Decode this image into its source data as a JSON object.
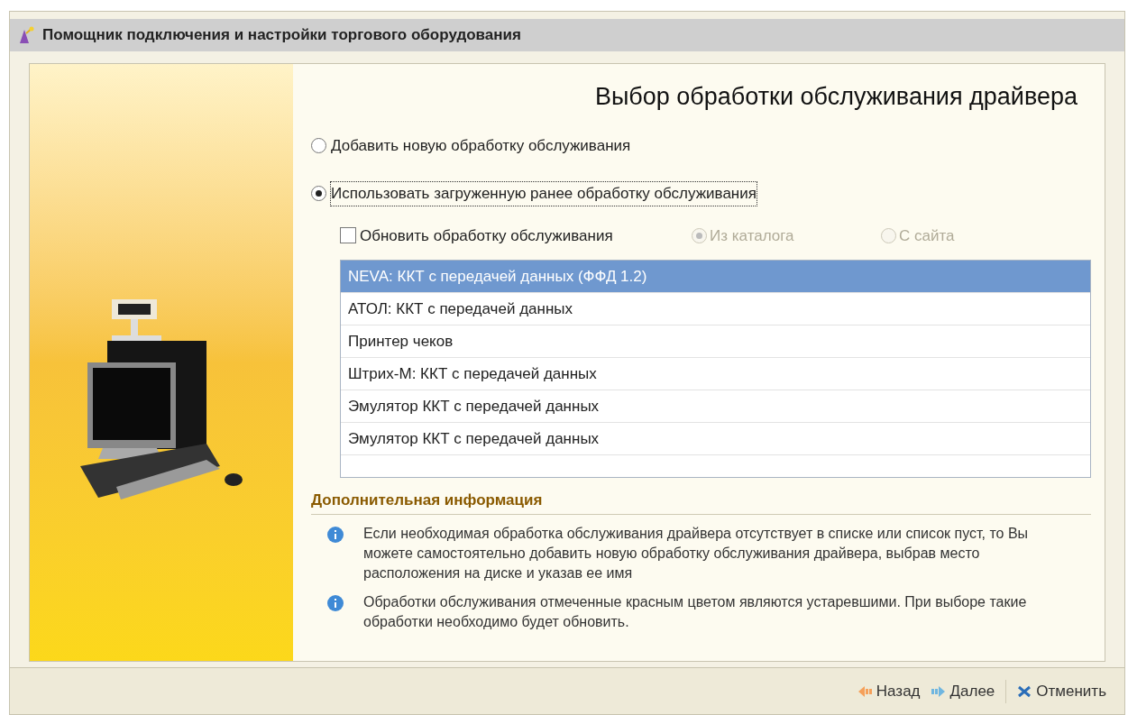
{
  "window": {
    "title": "Помощник подключения и настройки торгового оборудования"
  },
  "heading": "Выбор обработки обслуживания драйвера",
  "options": [
    {
      "label": "Добавить новую обработку обслуживания",
      "selected": false,
      "focused": false
    },
    {
      "label": "Использовать загруженную ранее обработку обслуживания",
      "selected": true,
      "focused": true
    }
  ],
  "update": {
    "label": "Обновить обработку обслуживания",
    "checked": false
  },
  "sources": [
    {
      "label": "Из каталога",
      "selected": true,
      "disabled": true
    },
    {
      "label": "С сайта",
      "selected": false,
      "disabled": true
    }
  ],
  "list": [
    {
      "label": "NEVA: ККТ с передачей данных (ФФД 1.2)",
      "selected": true
    },
    {
      "label": "АТОЛ: ККТ с передачей данных",
      "selected": false
    },
    {
      "label": "Принтер чеков",
      "selected": false
    },
    {
      "label": "Штрих-М: ККТ с передачей данных",
      "selected": false
    },
    {
      "label": "Эмулятор ККТ с передачей данных",
      "selected": false
    },
    {
      "label": "Эмулятор ККТ с передачей данных",
      "selected": false
    }
  ],
  "info": {
    "title": "Дополнительная информация",
    "items": [
      "Если необходимая обработка обслуживания драйвера отсутствует в списке или список пуст, то Вы можете самостоятельно добавить новую обработку обслуживания драйвера, выбрав место расположения на диске и указав ее имя",
      "Обработки обслуживания отмеченные красным цветом являются устаревшими. При выборе такие обработки необходимо будет обновить."
    ]
  },
  "buttons": [
    {
      "kind": "back",
      "label": "Назад"
    },
    {
      "kind": "next",
      "label": "Далее"
    },
    {
      "kind": "cancel",
      "label": "Отменить"
    }
  ]
}
